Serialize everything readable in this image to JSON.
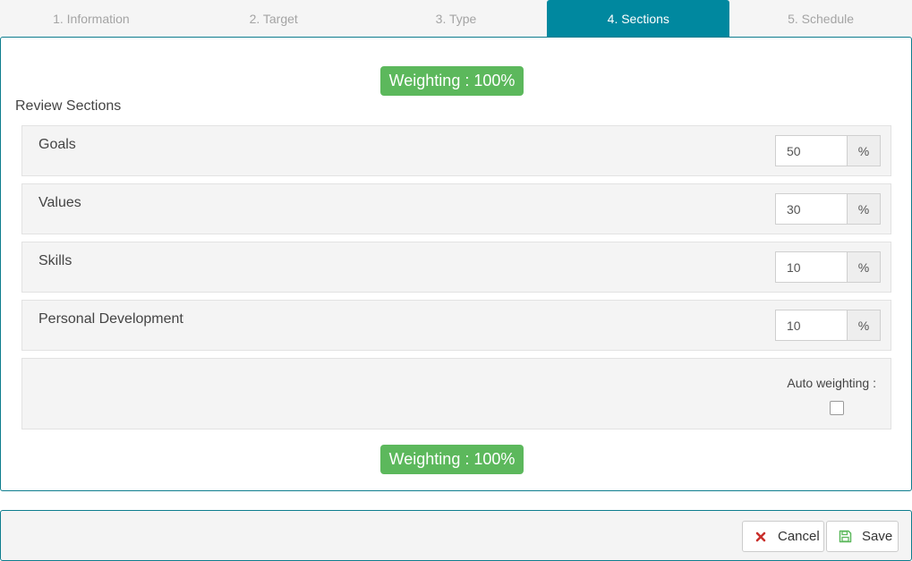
{
  "tabs": [
    {
      "label": "1. Information",
      "active": false
    },
    {
      "label": "2. Target",
      "active": false
    },
    {
      "label": "3. Type",
      "active": false
    },
    {
      "label": "4. Sections",
      "active": true
    },
    {
      "label": "5. Schedule",
      "active": false
    }
  ],
  "weighting": {
    "top_label": "Weighting : 100%",
    "bottom_label": "Weighting : 100%"
  },
  "review": {
    "title": "Review Sections",
    "sections": [
      {
        "name": "Goals",
        "value": "50",
        "unit": "%"
      },
      {
        "name": "Values",
        "value": "30",
        "unit": "%"
      },
      {
        "name": "Skills",
        "value": "10",
        "unit": "%"
      },
      {
        "name": "Personal Development",
        "value": "10",
        "unit": "%"
      }
    ],
    "auto_weighting_label": "Auto weighting :",
    "auto_weighting_checked": false
  },
  "footer": {
    "cancel_label": "Cancel",
    "save_label": "Save"
  },
  "colors": {
    "active_tab": "#00889f",
    "badge_green": "#5cb85c",
    "cancel_icon": "#c9302c",
    "save_icon": "#5cb85c"
  },
  "icons": {
    "cancel": "close-icon",
    "save": "floppy-disk-icon"
  }
}
